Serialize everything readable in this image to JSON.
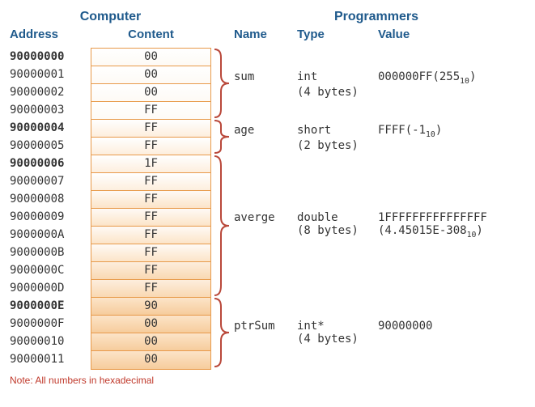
{
  "headers": {
    "computer": "Computer",
    "programmers": "Programmers",
    "address": "Address",
    "content": "Content",
    "name": "Name",
    "type": "Type",
    "value": "Value"
  },
  "memory": [
    {
      "addr": "90000000",
      "content": "00",
      "bold": true
    },
    {
      "addr": "90000001",
      "content": "00",
      "bold": false
    },
    {
      "addr": "90000002",
      "content": "00",
      "bold": false
    },
    {
      "addr": "90000003",
      "content": "FF",
      "bold": false
    },
    {
      "addr": "90000004",
      "content": "FF",
      "bold": true
    },
    {
      "addr": "90000005",
      "content": "FF",
      "bold": false
    },
    {
      "addr": "90000006",
      "content": "1F",
      "bold": true
    },
    {
      "addr": "90000007",
      "content": "FF",
      "bold": false
    },
    {
      "addr": "90000008",
      "content": "FF",
      "bold": false
    },
    {
      "addr": "90000009",
      "content": "FF",
      "bold": false
    },
    {
      "addr": "9000000A",
      "content": "FF",
      "bold": false
    },
    {
      "addr": "9000000B",
      "content": "FF",
      "bold": false
    },
    {
      "addr": "9000000C",
      "content": "FF",
      "bold": false
    },
    {
      "addr": "9000000D",
      "content": "FF",
      "bold": false
    },
    {
      "addr": "9000000E",
      "content": "90",
      "bold": true
    },
    {
      "addr": "9000000F",
      "content": "00",
      "bold": false
    },
    {
      "addr": "90000010",
      "content": "00",
      "bold": false
    },
    {
      "addr": "90000011",
      "content": "00",
      "bold": false
    }
  ],
  "vars": [
    {
      "name": "sum",
      "type": "int",
      "size": "(4 bytes)",
      "value_main": "000000FF(255",
      "value_sub": "10",
      "value_tail": ")"
    },
    {
      "name": "age",
      "type": "short",
      "size": "(2 bytes)",
      "value_main": "FFFF(-1",
      "value_sub": "10",
      "value_tail": ")"
    },
    {
      "name": "averge",
      "type": "double",
      "size": "(8 bytes)",
      "value_main": "1FFFFFFFFFFFFFFF",
      "value_sub": "",
      "value_tail": "",
      "value2_main": "(4.45015E-308",
      "value2_sub": "10",
      "value2_tail": ")"
    },
    {
      "name": "ptrSum",
      "type": "int*",
      "size": "(4 bytes)",
      "value_main": "90000000",
      "value_sub": "",
      "value_tail": ""
    }
  ],
  "note": "Note: All numbers in hexadecimal"
}
